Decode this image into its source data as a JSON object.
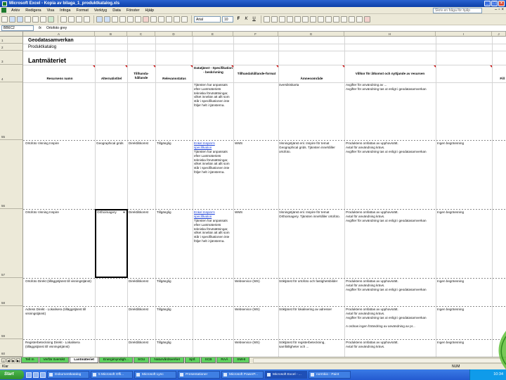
{
  "window": {
    "title": "Microsoft Excel - Kopia av bilaga_1_produktkatalog.xls"
  },
  "menu": {
    "items": [
      "Arkiv",
      "Redigera",
      "Visa",
      "Infoga",
      "Format",
      "Verktyg",
      "Data",
      "Fönster",
      "Hjälp"
    ],
    "help_placeholder": "Skriv en fråga för hjälp"
  },
  "toolbar": {
    "font": "Arial",
    "size": "10"
  },
  "formula_bar": {
    "cell_ref": "BB6C2",
    "fx": "fx",
    "content": "Ortofoto grey"
  },
  "columns": [
    "A",
    "B",
    "C",
    "D",
    "E",
    "F",
    "G",
    "H",
    "I",
    "J",
    "K",
    "L"
  ],
  "sheet": {
    "row1": "Geodatasamverkan",
    "row2": "Produktkatalog",
    "row3": "Lantmäteriet",
    "headers": {
      "resursens_namn": "Resursens namn",
      "alternativtitel": "Alternativtitel",
      "tillhandahallande": "Tillhanda-hållande",
      "relevans": "Relevansstatus",
      "datatjanst": "Datatjänst - Specifikation - beskrivning",
      "tillhandahallande_format": "Tillhandahållande-format",
      "amnesomrade": "Ämnesområde",
      "villkor": "Villkor för åtkomst och nyttjande av resursen",
      "fill": "Fill"
    },
    "row_numbers": [
      "1",
      "2",
      "3",
      "4",
      "55",
      "56",
      "57",
      "58",
      "59",
      "60"
    ],
    "rows": [
      {
        "namn": "",
        "alt": "",
        "tillh": "",
        "rel": "",
        "spec": "Tjänsten har anpassats efter Lantmäteriets tekniska förutsättningar, vilket innebär att allt som står i specifikationen inte följer helt i tjänsterna.",
        "format": "",
        "amne": "",
        "villkor_lines": [
          "Avgifter för användning av ...",
          "Avgifter för användning tas ut enligt i geodatasamverkan"
        ],
        "fill": ""
      },
      {
        "namn": "Ortofoto Visning Inspire",
        "alt": "Geographical grids",
        "tillh": "Direktåtkomst",
        "rel": "Tillgänglig",
        "link": "Enkel Inspire's specifikation",
        "spec": "Tjänsten har anpassats efter Lantmäteriets tekniska förutsättningar, vilket innebär att allt som står i specifikationen inte följer helt i tjänsterna.",
        "format": "WMS",
        "amne": "Visningstjänst enl. Inspire för temat Geographical grids. Tjänsten innehåller ortofoto.",
        "villkor_lines": [
          "Produktens omfattas av upphovsrätt.",
          "Avtal för användning krävs.",
          "Avgifter för användning tas ut enligt i geodatasamverkan"
        ],
        "fill": "Ingen begränsning"
      },
      {
        "namn": "Ortofoto Visning Inspire",
        "alt": "Orthoimagery",
        "tillh": "Direktåtkomst",
        "rel": "Tillgänglig",
        "link": "Enkel Inspire's specifikation",
        "spec": "Tjänsten har anpassats efter Lantmäteriets tekniska förutsättningar, vilket innebär att allt som står i specifikationen inte följer helt i tjänsterna.",
        "format": "WMS",
        "amne": "Visningstjänst enl. Inspire för temat Orthoimagery. Tjänsten innehåller ortofoto.",
        "villkor_lines": [
          "Produktens omfattas av upphovsrätt.",
          "Avtal för användning krävs.",
          "Avgifter för användning tas ut enligt i geodatasamverkan"
        ],
        "fill": "Ingen begränsning"
      },
      {
        "namn": "Ortofoto Direkt (tilläggstjänst till visningstjänst)",
        "alt": "",
        "tillh": "Direktåtkomst",
        "rel": "Tillgänglig",
        "link": "",
        "spec": "",
        "format": "Webservice (WS)",
        "amne": "Söktjänst för ortofoto och fastighetsbilder",
        "villkor_lines": [
          "Produktens omfattas av upphovsrätt.",
          "Avtal för användning krävs.",
          "Avgifter för användning tas ut enligt i geodatasamverkan"
        ],
        "fill": "Ingen begränsning"
      },
      {
        "namn": "Adress Direkt - Lokalisera (tilläggstjänst till visningstjänst)",
        "alt": "",
        "tillh": "Direktåtkomst",
        "rel": "Tillgänglig",
        "link": "",
        "spec": "",
        "format": "Webservice (WS)",
        "amne": "Söktjänst för lokalisering av adresser",
        "villkor_lines": [
          "Produktens omfattas av upphovsrätt.",
          "Avtal för användning krävs.",
          "Avgifter för användning tas ut enligt i geodatasamverkan",
          "A ordnas ingen förändring av användning av pr..."
        ],
        "fill": "Ingen begränsning"
      },
      {
        "namn": "Registerbeteckning Direkt - Lokalisera (tilläggstjänst till visningstjänst)",
        "alt": "",
        "tillh": "Direktåtkomst",
        "rel": "Tillgänglig",
        "link": "",
        "spec": "",
        "format": "Webservice (WS)",
        "amne": "Söktjänst för registerbeteckning, samfälligheter och ...",
        "villkor_lines": [
          "Produktens omfattas av upphovsrätt.",
          "Avtal för användning krävs."
        ],
        "fill": "Ingen begränsning"
      }
    ],
    "cell_dropdown_value": "Orthoimagery"
  },
  "tabs": [
    "Tell m",
    "Verfär översikt",
    "Lantmäteriet",
    "Energimyndigh...",
    "SGU",
    "Naturvårdsverket",
    "Sjöf.",
    "SCB",
    "RAÄ",
    "SMHI"
  ],
  "active_tab": 2,
  "status": {
    "ready": "Klar",
    "num": "NUM"
  },
  "taskbar": {
    "start": "Start",
    "items": [
      "Dokumentkatalog",
      "5 Microsoft Offi...",
      "Microsoft Lync",
      "Presentationer",
      "Microsoft PowerP...",
      "Microsoft Excel - ...",
      "normkio - Paint"
    ],
    "active_item": 5,
    "clock": "10:34"
  },
  "colors": {
    "tab_green": "#5fd35f",
    "title_blue": "#0b3fa8",
    "link_blue": "#1a3fd6"
  }
}
